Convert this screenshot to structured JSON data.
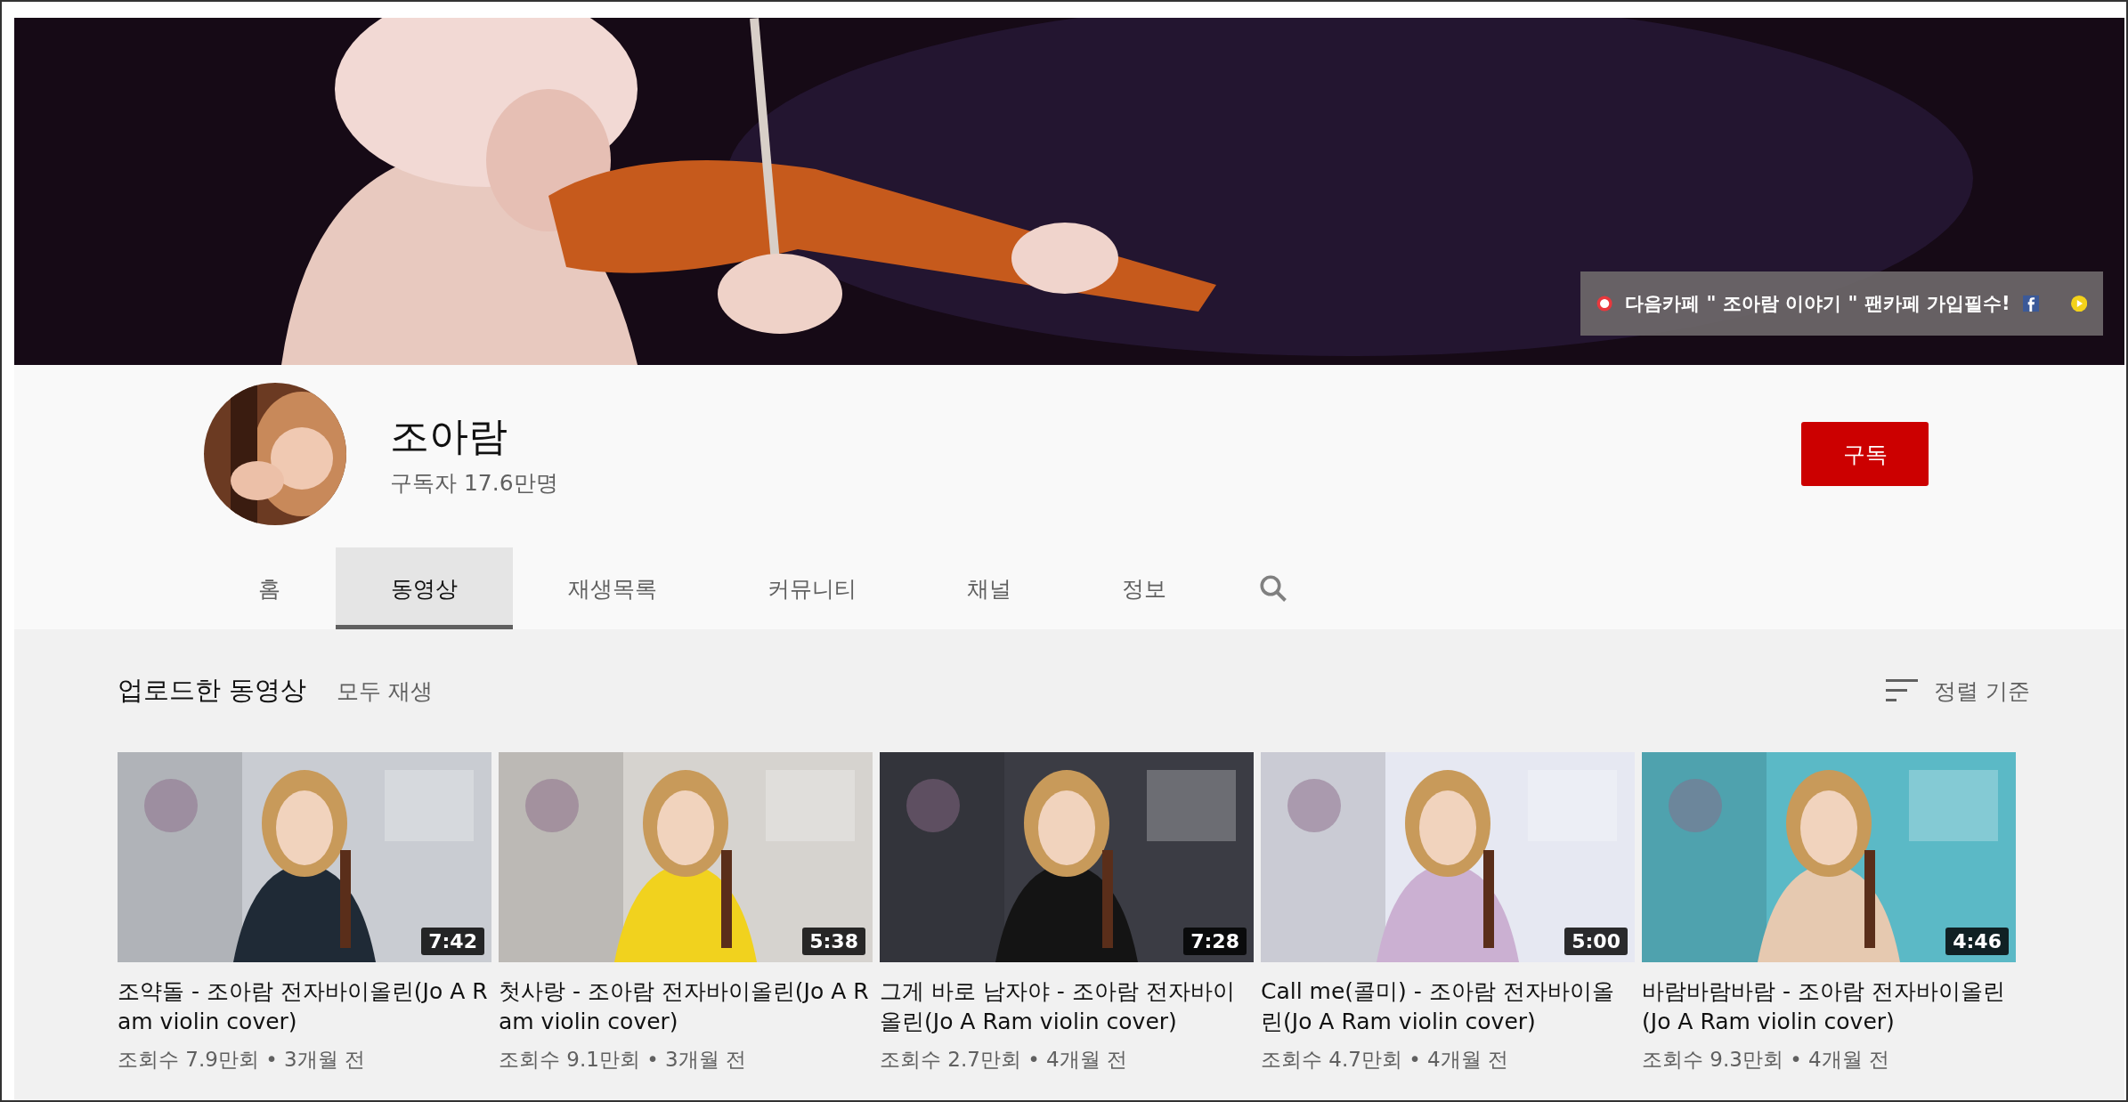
{
  "banner": {
    "link_text": "다음카페 \" 조아람 이야기 \" 팬카페 가입필수!"
  },
  "channel": {
    "name": "조아람",
    "subscribers": "구독자 17.6만명",
    "subscribe_button": "구독"
  },
  "tabs": [
    {
      "label": "홈",
      "selected": false
    },
    {
      "label": "동영상",
      "selected": true
    },
    {
      "label": "재생목록",
      "selected": false
    },
    {
      "label": "커뮤니티",
      "selected": false
    },
    {
      "label": "채널",
      "selected": false
    },
    {
      "label": "정보",
      "selected": false
    }
  ],
  "section": {
    "title": "업로드한 동영상",
    "play_all": "모두 재생",
    "sort": "정렬 기준"
  },
  "videos": [
    {
      "title": "조약돌 - 조아람 전자바이올린(Jo A Ram violin cover)",
      "duration": "7:42",
      "meta": "조회수 7.9만회 • 3개월 전"
    },
    {
      "title": "첫사랑 - 조아람 전자바이올린(Jo A Ram violin cover)",
      "duration": "5:38",
      "meta": "조회수 9.1만회 • 3개월 전"
    },
    {
      "title": "그게 바로 남자야 - 조아람 전자바이올린(Jo A Ram violin cover)",
      "duration": "7:28",
      "meta": "조회수 2.7만회 • 4개월 전"
    },
    {
      "title": "Call me(콜미) - 조아람 전자바이올린(Jo A Ram violin cover)",
      "duration": "5:00",
      "meta": "조회수 4.7만회 • 4개월 전"
    },
    {
      "title": "바람바람바람 - 조아람 전자바이올린(Jo A Ram violin cover)",
      "duration": "4:46",
      "meta": "조회수 9.3만회 • 4개월 전"
    }
  ]
}
